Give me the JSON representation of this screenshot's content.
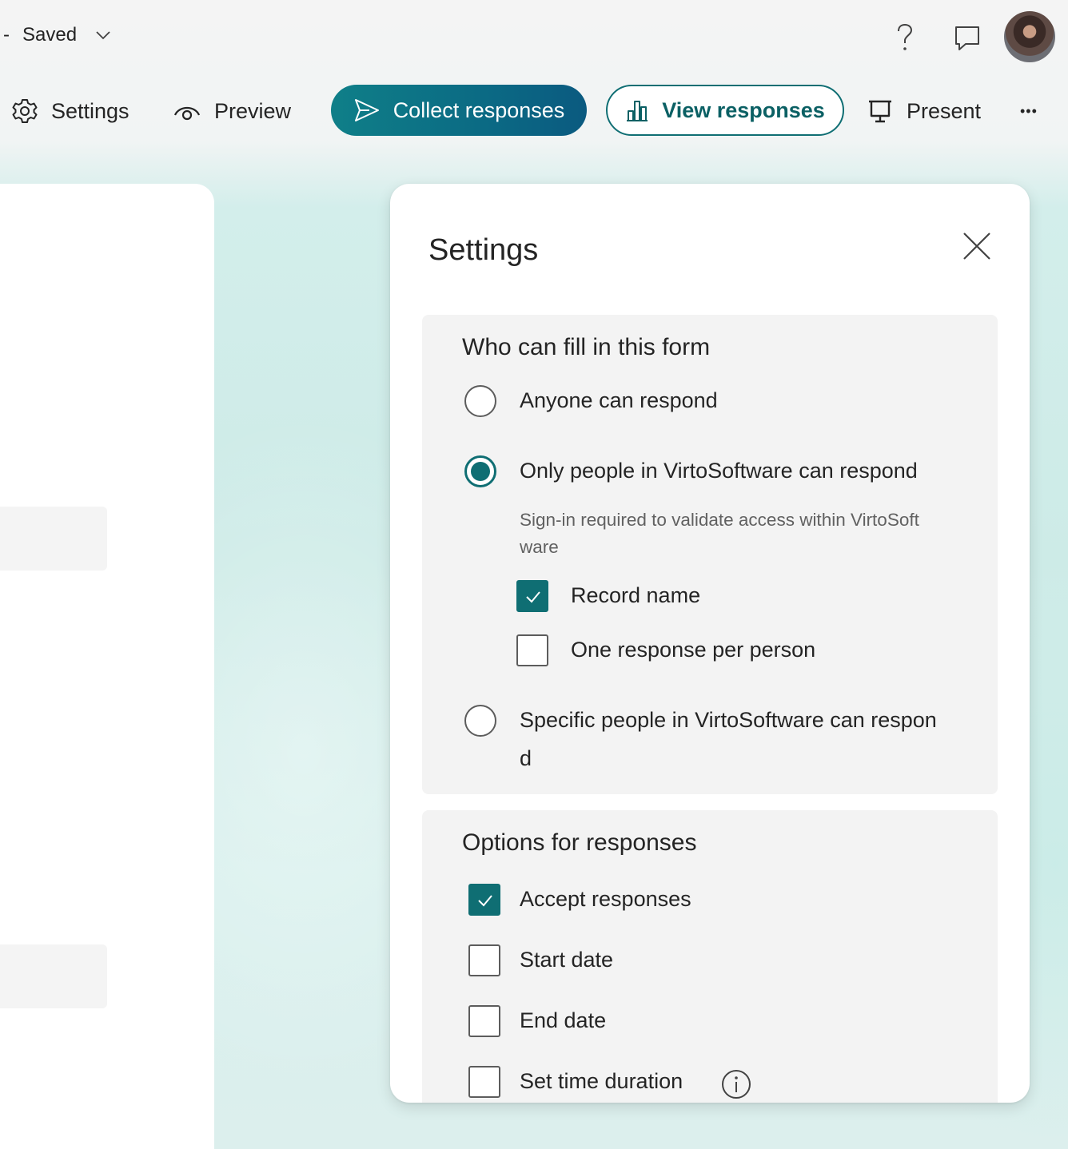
{
  "topbar": {
    "dash": "-",
    "status": "Saved",
    "icons": [
      "chevron-down-icon",
      "help-icon",
      "chat-icon",
      "avatar"
    ]
  },
  "toolbar": {
    "settings_label": "Settings",
    "preview_label": "Preview",
    "collect_label": "Collect responses",
    "view_label": "View responses",
    "present_label": "Present",
    "more_label": "•••"
  },
  "panel": {
    "title": "Settings",
    "who": {
      "title": "Who can fill in this form",
      "options": [
        {
          "label": "Anyone can respond",
          "selected": false
        },
        {
          "label": "Only people in VirtoSoftware can respond",
          "selected": true
        },
        {
          "label": "Specific people in VirtoSoftware can respon",
          "label_wrap": "d",
          "selected": false
        }
      ],
      "hint_line1": "Sign-in required to validate access within VirtoSoft",
      "hint_line2": "ware",
      "sub_options": [
        {
          "label": "Record name",
          "checked": true
        },
        {
          "label": "One response per person",
          "checked": false
        }
      ]
    },
    "responses": {
      "title": "Options for responses",
      "options": [
        {
          "label": "Accept responses",
          "checked": true
        },
        {
          "label": "Start date",
          "checked": false
        },
        {
          "label": "End date",
          "checked": false
        },
        {
          "label": "Set time duration",
          "checked": false,
          "info_icon": "info-icon"
        }
      ]
    }
  },
  "colors": {
    "accent": "#0f6e73",
    "collect_button": "#0b6a84",
    "panel_bg": "#ffffff",
    "section_bg": "#f3f3f3"
  }
}
